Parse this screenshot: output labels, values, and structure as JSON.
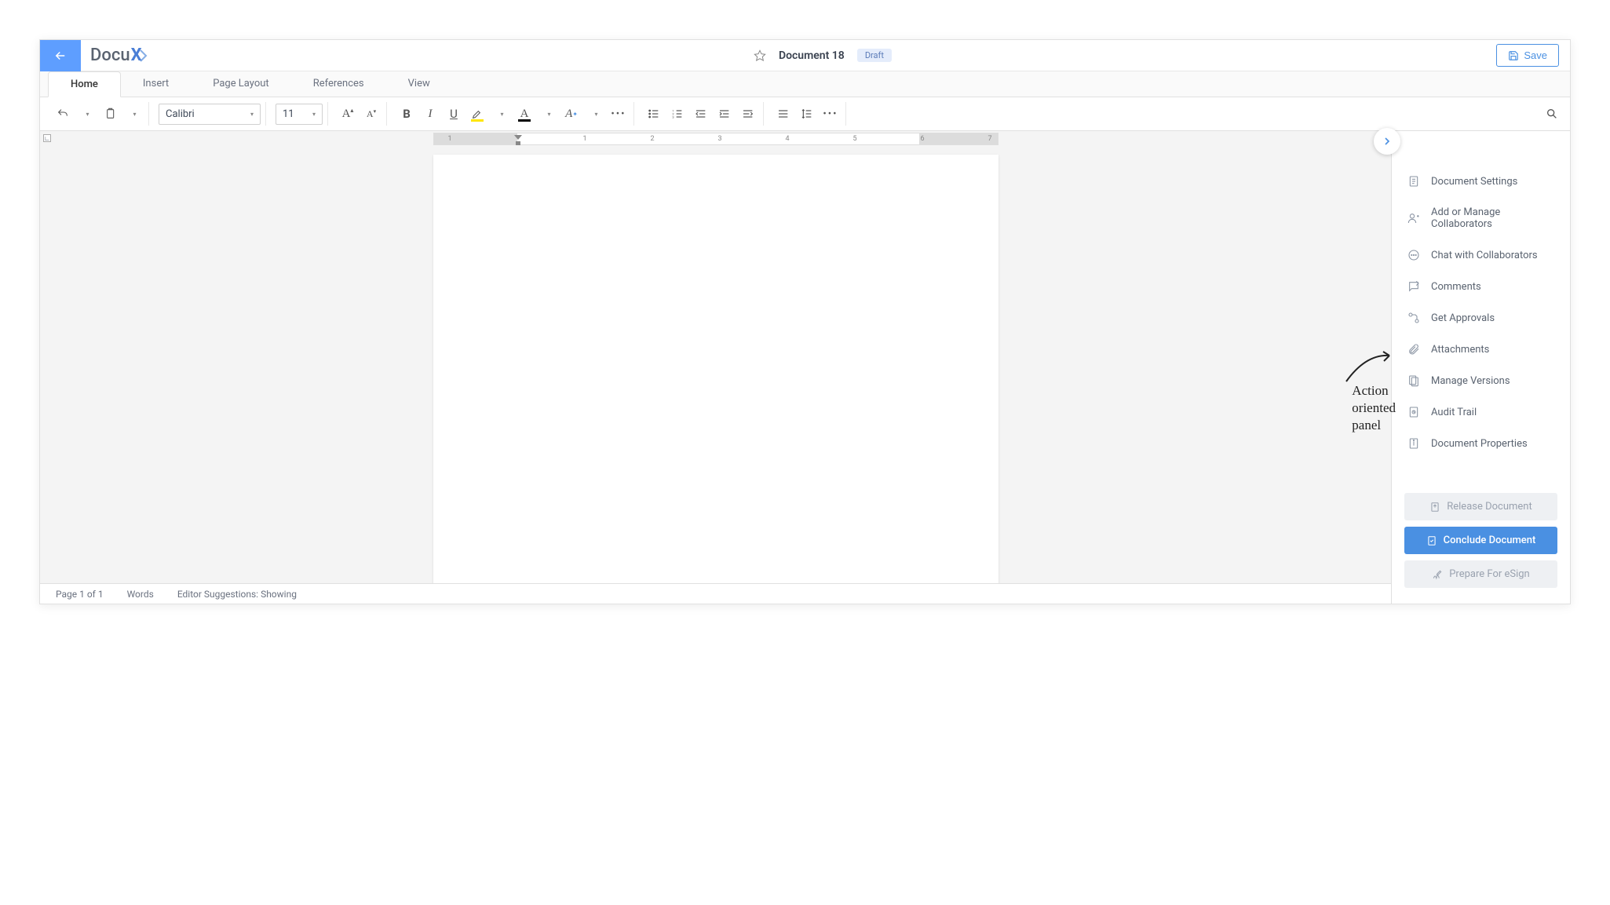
{
  "header": {
    "logo_text": "Docu",
    "logo_suffix": "X",
    "doc_title": "Document 18",
    "badge": "Draft",
    "save_label": "Save"
  },
  "ribbon_tabs": [
    "Home",
    "Insert",
    "Page Layout",
    "References",
    "View"
  ],
  "toolbar": {
    "font_name": "Calibri",
    "font_size": "11",
    "ruler_marks": [
      "1",
      "1",
      "2",
      "3",
      "4",
      "5",
      "6",
      "7"
    ]
  },
  "right_panel": {
    "items": [
      "Document Settings",
      "Add or Manage Collaborators",
      "Chat with Collaborators",
      "Comments",
      "Get Approvals",
      "Attachments",
      "Manage Versions",
      "Audit Trail",
      "Document Properties"
    ],
    "footer": {
      "release": "Release Document",
      "conclude": "Conclude Document",
      "esign": "Prepare For eSign"
    }
  },
  "statusbar": {
    "page_info": "Page  1  of  1",
    "words_label": "Words",
    "suggestions": "Editor Suggestions: Showing"
  },
  "annotation": {
    "line1": "Action",
    "line2": "oriented",
    "line3": "panel"
  }
}
